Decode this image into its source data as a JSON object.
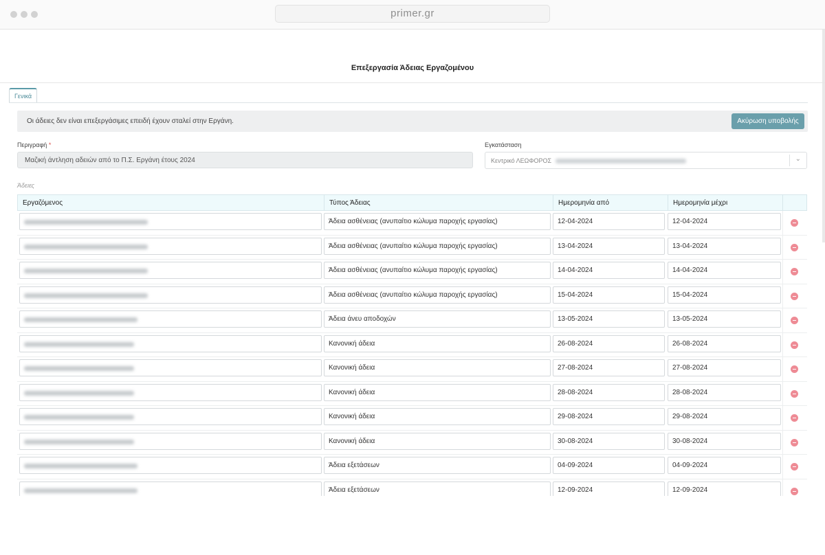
{
  "browser": {
    "url": "primer.gr"
  },
  "page": {
    "title": "Επεξεργασία Άδειας Εργαζομένου"
  },
  "tabs": [
    {
      "label": "Γενικά"
    }
  ],
  "alert": {
    "message": "Οι άδειες δεν είναι επεξεργάσιμες επειδή έχουν σταλεί στην Εργάνη.",
    "button_label": "Ακύρωση υποβολής"
  },
  "form": {
    "description_label": "Περιγραφή",
    "description_required_mark": "*",
    "description_value": "Μαζική άντληση αδειών από το Π.Σ. Εργάνη έτους 2024",
    "installation_label": "Εγκατάσταση",
    "installation_value": "Κεντρικό ΛΕΩΦΟΡΟΣ"
  },
  "leaves": {
    "section_label": "Άδειες",
    "headers": [
      "Εργαζόμενος",
      "Τύπος Άδειας",
      "Ημερομηνία από",
      "Ημερομηνία μέχρι"
    ],
    "rows": [
      {
        "type": "Άδεια ασθένειας (ανυπαίτιο κώλυμα παροχής εργασίας)",
        "from": "12-04-2024",
        "to": "12-04-2024"
      },
      {
        "type": "Άδεια ασθένειας (ανυπαίτιο κώλυμα παροχής εργασίας)",
        "from": "13-04-2024",
        "to": "13-04-2024"
      },
      {
        "type": "Άδεια ασθένειας (ανυπαίτιο κώλυμα παροχής εργασίας)",
        "from": "14-04-2024",
        "to": "14-04-2024"
      },
      {
        "type": "Άδεια ασθένειας (ανυπαίτιο κώλυμα παροχής εργασίας)",
        "from": "15-04-2024",
        "to": "15-04-2024"
      },
      {
        "type": "Άδεια άνευ αποδοχών",
        "from": "13-05-2024",
        "to": "13-05-2024"
      },
      {
        "type": "Κανονική άδεια",
        "from": "26-08-2024",
        "to": "26-08-2024"
      },
      {
        "type": "Κανονική άδεια",
        "from": "27-08-2024",
        "to": "27-08-2024"
      },
      {
        "type": "Κανονική άδεια",
        "from": "28-08-2024",
        "to": "28-08-2024"
      },
      {
        "type": "Κανονική άδεια",
        "from": "29-08-2024",
        "to": "29-08-2024"
      },
      {
        "type": "Κανονική άδεια",
        "from": "30-08-2024",
        "to": "30-08-2024"
      },
      {
        "type": "Άδεια εξετάσεων",
        "from": "04-09-2024",
        "to": "04-09-2024"
      },
      {
        "type": "Άδεια εξετάσεων",
        "from": "12-09-2024",
        "to": "12-09-2024"
      }
    ]
  },
  "icons": {
    "remove": "minus-circle-icon",
    "dropdown": "chevron-down-icon"
  },
  "colors": {
    "accent": "#6a9fab",
    "remove": "#ee8b95",
    "header_bg": "#eefafc"
  }
}
